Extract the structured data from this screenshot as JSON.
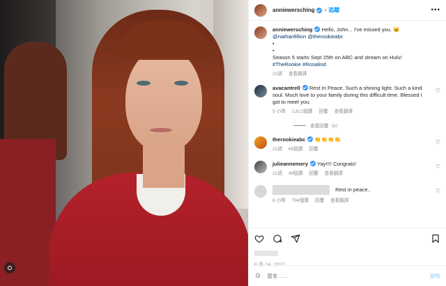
{
  "post": {
    "username": "anniewersching",
    "follow_label": "追蹤",
    "more_icon": "more-horizontal-icon",
    "caption": {
      "line1": "Hello, John... I've missed you. 🐱",
      "mentions": "@nathanfillion @therookieabc",
      "dot1": "•",
      "dot2": "•",
      "line4": "Season 5 starts Sept 25th on ABC and stream on Hulu!",
      "hashtags": "#TheRookie #Rosalind",
      "time": "22週",
      "translate": "查看翻譯"
    },
    "date": "8 月 24, 2022"
  },
  "comments": [
    {
      "user": "avacantrell",
      "text": "Rest In Peace. Such a shining light. Such a kind soul. Much love to your family during this difficult time. Blessed I got to meet you.",
      "time": "5 小時",
      "likes": "1,812個讚",
      "reply": "回覆",
      "translate": "查看翻譯",
      "view_replies": "查看回覆（6）"
    },
    {
      "user": "therookieabc",
      "text": "👏👏👏👏",
      "time": "22週",
      "likes": "85個讚",
      "reply": "回覆"
    },
    {
      "user": "julieannemery",
      "text": "Yay!!!! Congrats!",
      "time": "22週",
      "likes": "49個讚",
      "reply": "回覆",
      "translate": "查看翻譯"
    },
    {
      "text": "Rest in peace..",
      "time": "6 小時",
      "likes": "794個讚",
      "reply": "回覆",
      "translate": "查看翻譯"
    }
  ],
  "composer": {
    "placeholder": "留言……",
    "post_label": "發佈"
  },
  "icons": {
    "like": "heart-icon",
    "comment": "comment-icon",
    "share": "share-icon",
    "save": "bookmark-icon",
    "emoji": "emoji-icon"
  },
  "colors": {
    "link": "#00376b",
    "accent": "#0095f6",
    "muted": "#8e8e8e"
  }
}
